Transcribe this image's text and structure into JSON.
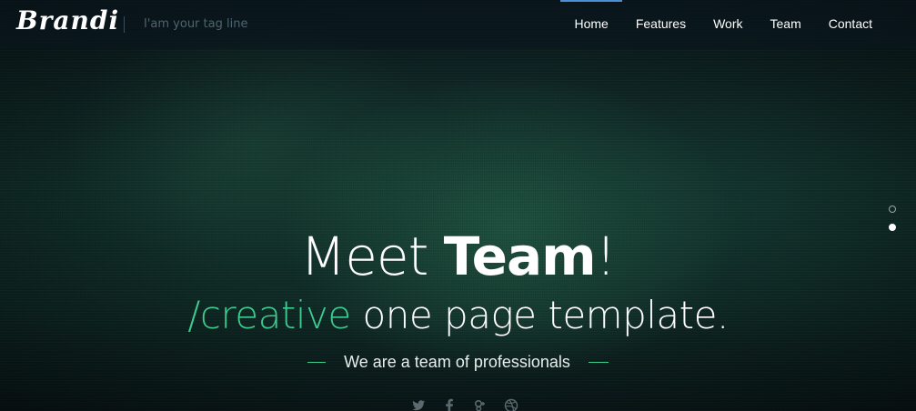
{
  "brand": {
    "logo": "Brandi",
    "tagline": "I'am your tag line"
  },
  "nav": {
    "items": [
      {
        "label": "Home",
        "active": true
      },
      {
        "label": "Features",
        "active": false
      },
      {
        "label": "Work",
        "active": false
      },
      {
        "label": "Team",
        "active": false
      },
      {
        "label": "Contact",
        "active": false
      }
    ]
  },
  "slider": {
    "dots": 2,
    "active_dot": 2
  },
  "hero": {
    "headline_light": "Meet ",
    "headline_bold": "Team",
    "headline_end": "!",
    "subhead_accent": "/creative",
    "subhead_rest": " one page template.",
    "tagline": "We are a team of professionals"
  },
  "social": {
    "icons": [
      "twitter-icon",
      "facebook-icon",
      "google-plus-icon",
      "dribbble-icon"
    ]
  },
  "colors": {
    "accent": "#3ec98f",
    "nav_active_indicator": "#4a8fd4"
  }
}
